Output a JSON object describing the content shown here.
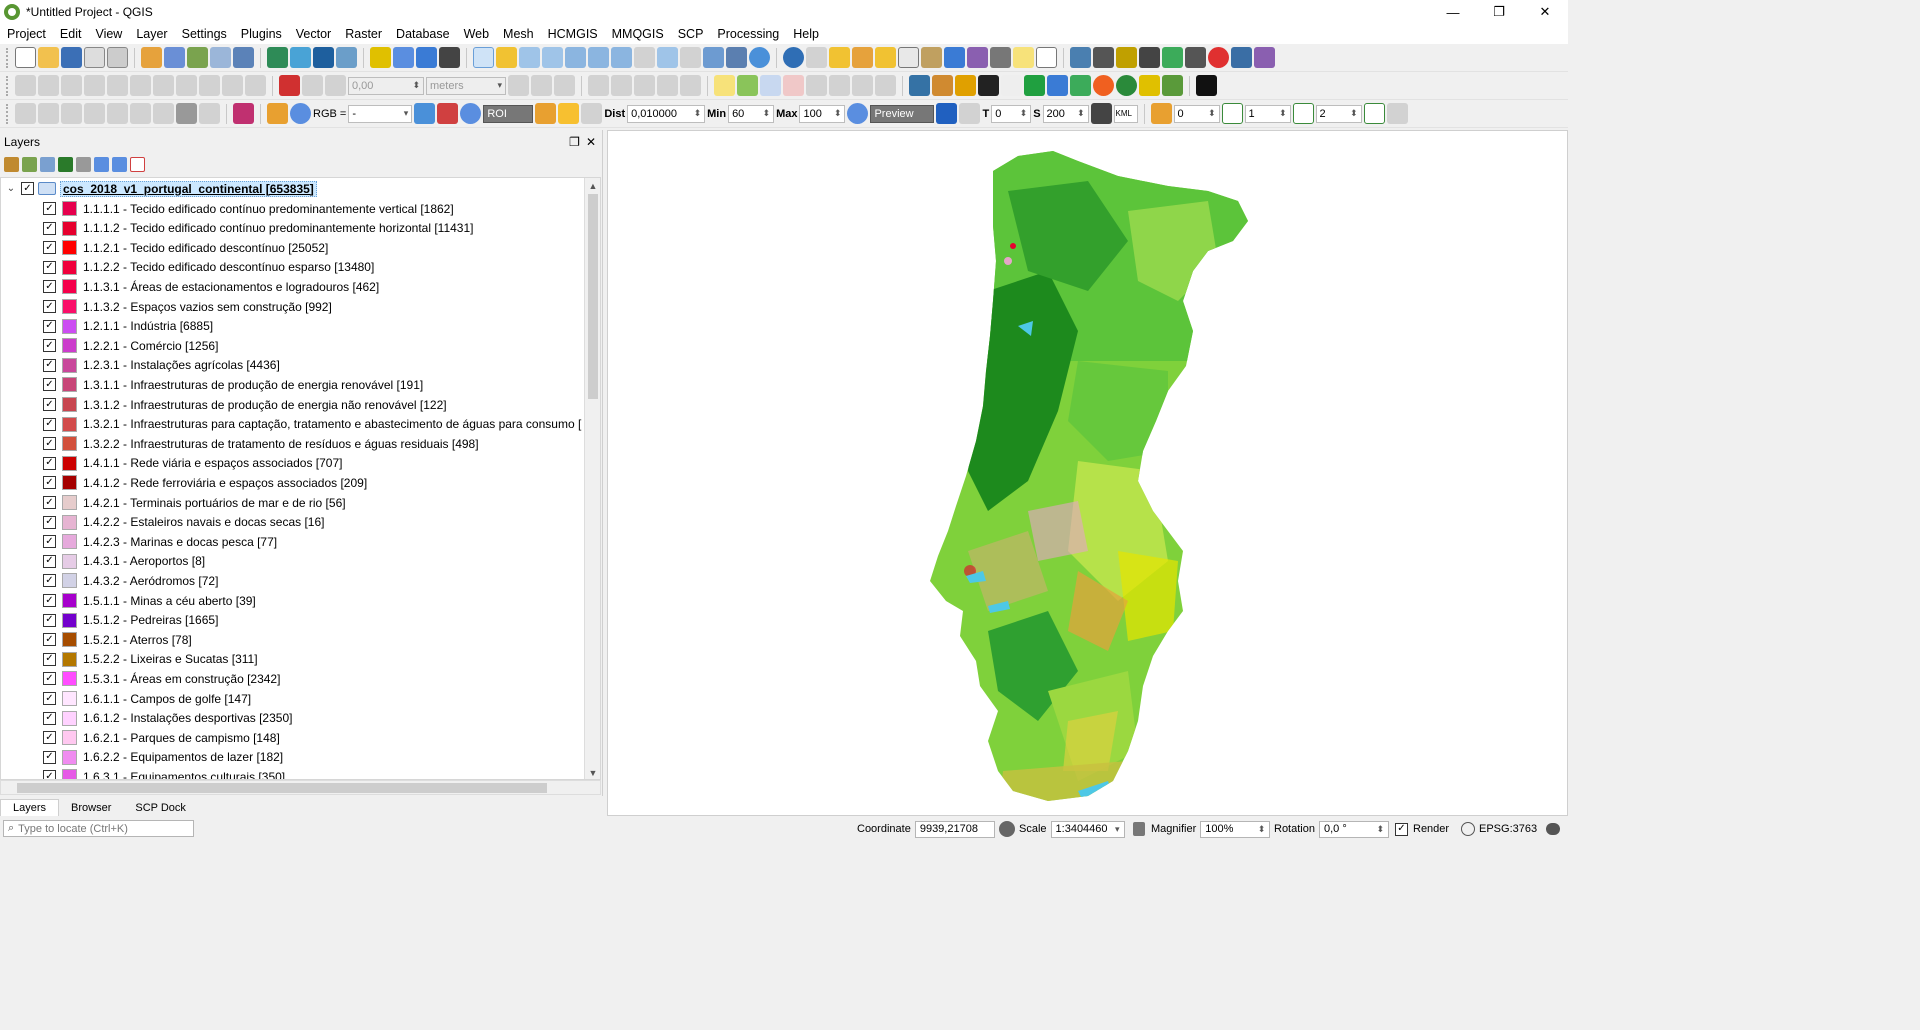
{
  "window": {
    "title": "*Untitled Project - QGIS",
    "minimize": "—",
    "restore": "❐",
    "close": "✕"
  },
  "menu": [
    "Project",
    "Edit",
    "View",
    "Layer",
    "Settings",
    "Plugins",
    "Vector",
    "Raster",
    "Database",
    "Web",
    "Mesh",
    "HCMGIS",
    "MMQGIS",
    "SCP",
    "Processing",
    "Help"
  ],
  "digitizing": {
    "value": "0,00",
    "units": "meters"
  },
  "scp": {
    "rgb_label": "RGB =",
    "rgb_value": "-",
    "roi": "ROI",
    "dist_label": "Dist",
    "dist_value": "0,010000",
    "min_label": "Min",
    "min_value": "60",
    "max_label": "Max",
    "max_value": "100",
    "preview": "Preview",
    "t_label": "T",
    "t_value": "0",
    "s_label": "S",
    "s_value": "200",
    "kml": "KML",
    "band_a": "0",
    "band_b": "1",
    "band_c": "2"
  },
  "layers_panel": {
    "title": "Layers",
    "parent": {
      "label": "cos_2018_v1_portugal_continental [653835]",
      "expand": "⌄"
    },
    "items": [
      {
        "label": "1.1.1.1 - Tecido edificado contínuo predominantemente vertical [1862]",
        "color": "#e6004d"
      },
      {
        "label": "1.1.1.2 - Tecido edificado contínuo predominantemente horizontal [11431]",
        "color": "#e6002e"
      },
      {
        "label": "1.1.2.1 - Tecido edificado descontínuo [25052]",
        "color": "#ff0000"
      },
      {
        "label": "1.1.2.2 - Tecido edificado descontínuo esparso [13480]",
        "color": "#f0003c"
      },
      {
        "label": "1.1.3.1 - Áreas de estacionamentos e logradouros [462]",
        "color": "#f5004b"
      },
      {
        "label": "1.1.3.2 - Espaços vazios sem construção [992]",
        "color": "#fa0f69"
      },
      {
        "label": "1.2.1.1 - Indústria [6885]",
        "color": "#cc4df2"
      },
      {
        "label": "1.2.2.1 - Comércio [1256]",
        "color": "#cc3ccc"
      },
      {
        "label": "1.2.3.1 - Instalações agrícolas [4436]",
        "color": "#c9479b"
      },
      {
        "label": "1.3.1.1 - Infraestruturas de produção de energia renovável [191]",
        "color": "#c84678"
      },
      {
        "label": "1.3.1.2 - Infraestruturas de produção de energia não renovável [122]",
        "color": "#c84650"
      },
      {
        "label": "1.3.2.1 - Infraestruturas para captação, tratamento e abastecimento de águas para consumo [",
        "color": "#d24b4b"
      },
      {
        "label": "1.3.2.2 - Infraestruturas de tratamento de resíduos e águas residuais [498]",
        "color": "#d2503c"
      },
      {
        "label": "1.4.1.1 - Rede viária e espaços associados [707]",
        "color": "#cc0000"
      },
      {
        "label": "1.4.1.2 - Rede ferroviária e espaços associados [209]",
        "color": "#a50000"
      },
      {
        "label": "1.4.2.1 - Terminais portuários de mar e de rio [56]",
        "color": "#e6cccc"
      },
      {
        "label": "1.4.2.2 - Estaleiros navais e docas secas [16]",
        "color": "#e6b4d2"
      },
      {
        "label": "1.4.2.3 - Marinas e docas pesca [77]",
        "color": "#e6aadc"
      },
      {
        "label": "1.4.3.1 - Aeroportos [8]",
        "color": "#e6cce6"
      },
      {
        "label": "1.4.3.2 - Aeródromos [72]",
        "color": "#d2d2e6"
      },
      {
        "label": "1.5.1.1 - Minas a céu aberto [39]",
        "color": "#a600cc"
      },
      {
        "label": "1.5.1.2 - Pedreiras [1665]",
        "color": "#7300cc"
      },
      {
        "label": "1.5.2.1 - Aterros [78]",
        "color": "#a64d00"
      },
      {
        "label": "1.5.2.2 - Lixeiras e Sucatas [311]",
        "color": "#b47800"
      },
      {
        "label": "1.5.3.1 - Áreas em construção [2342]",
        "color": "#ff4dff"
      },
      {
        "label": "1.6.1.1 - Campos de golfe [147]",
        "color": "#ffe6ff"
      },
      {
        "label": "1.6.1.2 - Instalações desportivas [2350]",
        "color": "#ffd2ff"
      },
      {
        "label": "1.6.2.1 - Parques de campismo [148]",
        "color": "#ffc8f0"
      },
      {
        "label": "1.6.2.2 - Equipamentos de lazer [182]",
        "color": "#f08cf0"
      },
      {
        "label": "1.6.3.1 - Equipamentos culturais [350]",
        "color": "#e65ae6"
      }
    ],
    "tabs": [
      "Layers",
      "Browser",
      "SCP Dock"
    ]
  },
  "statusbar": {
    "locator_placeholder": "Type to locate (Ctrl+K)",
    "coordinate_label": "Coordinate",
    "coordinate_value": "9939,21708",
    "scale_label": "Scale",
    "scale_value": "1:3404460",
    "magnifier_label": "Magnifier",
    "magnifier_value": "100%",
    "rotation_label": "Rotation",
    "rotation_value": "0,0 °",
    "render_label": "Render",
    "crs": "EPSG:3763"
  },
  "colors": {
    "forest_dark": "#1d8a1d",
    "forest": "#33a02c",
    "agri_green": "#7fd13b",
    "light_green": "#b6e24a",
    "yellow": "#e6e600",
    "orange": "#e6a33c",
    "pink": "#e6a5c8",
    "water": "#4dc8e6",
    "red": "#e6002e"
  }
}
